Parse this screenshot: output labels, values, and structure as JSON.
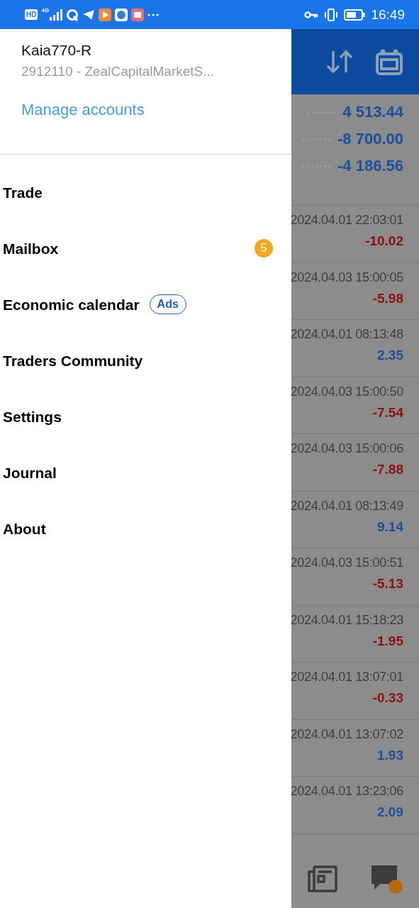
{
  "status_bar": {
    "hd": "HD",
    "network": "4G",
    "time": "16:49"
  },
  "drawer": {
    "account_name": "Kaia770-R",
    "account_server": "2912110 - ZealCapitalMarketS...",
    "manage_link": "Manage accounts",
    "menu": [
      {
        "label": "Trade"
      },
      {
        "label": "Mailbox",
        "badge": "5"
      },
      {
        "label": "Economic calendar",
        "tag": "Ads"
      },
      {
        "label": "Traders Community"
      },
      {
        "label": "Settings"
      },
      {
        "label": "Journal"
      },
      {
        "label": "About"
      }
    ]
  },
  "summary": [
    "4 513.44",
    "-8 700.00",
    "-4 186.56"
  ],
  "trades": [
    {
      "time": "2024.04.01 22:03:01",
      "profit": "-10.02",
      "color": "#8e1111"
    },
    {
      "time": "2024.04.03 15:00:05",
      "profit": "-5.98",
      "color": "#8e1111"
    },
    {
      "time": "2024.04.01 08:13:48",
      "profit": "2.35",
      "color": "#1c4f9c"
    },
    {
      "time": "2024.04.03 15:00:50",
      "profit": "-7.54",
      "color": "#8e1111"
    },
    {
      "time": "2024.04.03 15:00:06",
      "profit": "-7.88",
      "color": "#8e1111"
    },
    {
      "time": "2024.04.01 08:13:49",
      "profit": "9.14",
      "color": "#1c4f9c"
    },
    {
      "time": "2024.04.03 15:00:51",
      "profit": "-5.13",
      "color": "#8e1111"
    },
    {
      "time": "2024.04.01 15:18:23",
      "profit": "-1.95",
      "color": "#8e1111"
    },
    {
      "time": "2024.04.01 13:07:01",
      "profit": "-0.33",
      "color": "#8e1111"
    },
    {
      "time": "2024.04.01 13:07:02",
      "profit": "1.93",
      "color": "#1c4f9c"
    },
    {
      "time": "2024.04.01 13:23:06",
      "profit": "2.09",
      "color": "#1c4f9c"
    }
  ]
}
